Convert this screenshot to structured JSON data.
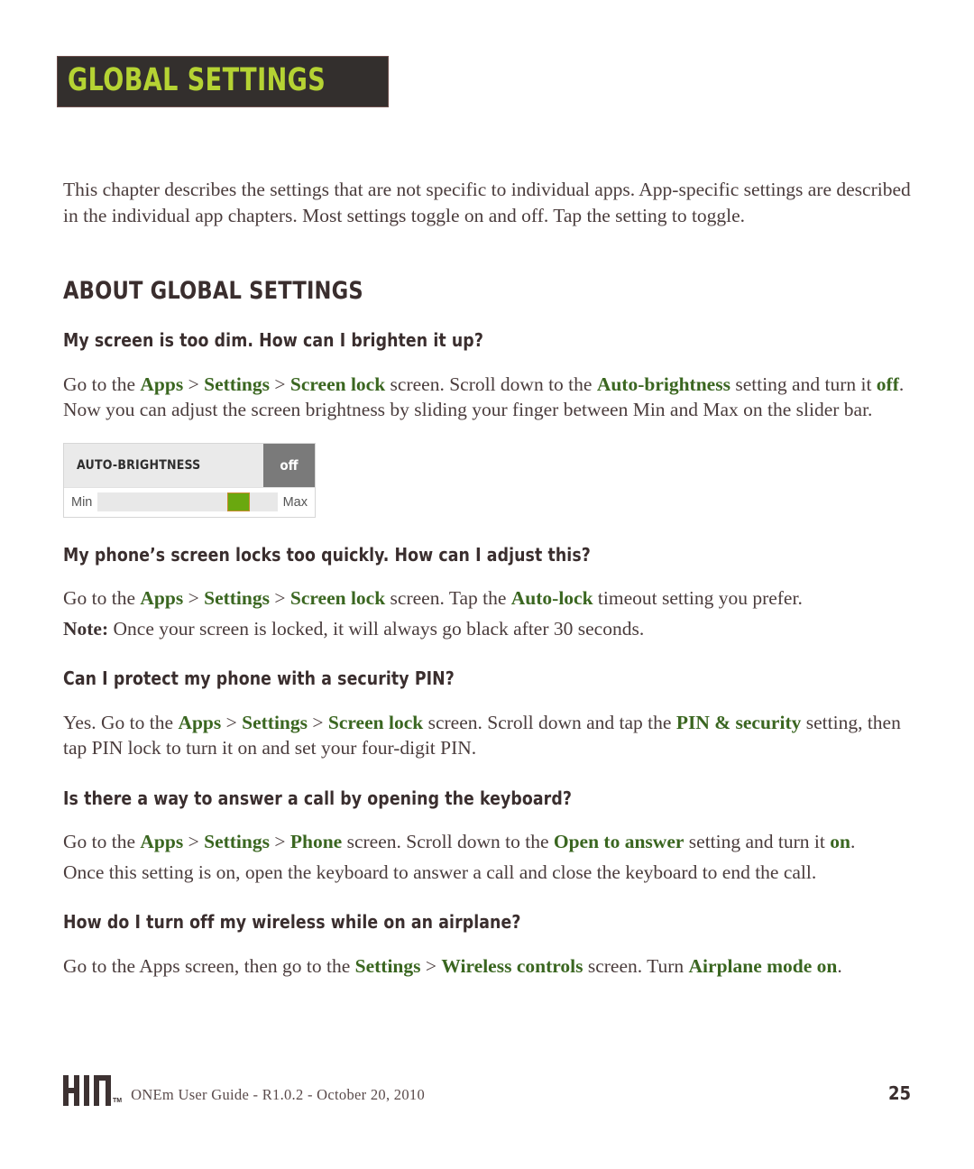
{
  "banner": {
    "title": "GLOBAL SETTINGS",
    "bg_color": "#332f2d",
    "text_color": "#b5d333"
  },
  "intro": {
    "paragraph": "This chapter describes the settings that are not specific to individual apps. App-specific settings are described in the individual app chapters. Most settings toggle on and off. Tap the setting to toggle."
  },
  "section": {
    "title": "ABOUT GLOBAL SETTINGS"
  },
  "accent_colors": {
    "green_term": "#3a6620",
    "heading": "#3a2e2e",
    "body": "#4a3c3c"
  },
  "faq": [
    {
      "question": "My screen is too dim. How can I brighten it up?",
      "answer_parts": [
        {
          "text": "Go to the ",
          "style": "plain"
        },
        {
          "text": "Apps",
          "style": "green"
        },
        {
          "text": " > ",
          "style": "plain"
        },
        {
          "text": "Settings",
          "style": "green"
        },
        {
          "text": " > ",
          "style": "plain"
        },
        {
          "text": "Screen lock",
          "style": "green"
        },
        {
          "text": " screen. Scroll down to the ",
          "style": "plain"
        },
        {
          "text": "Auto-brightness",
          "style": "green"
        },
        {
          "text": " setting and turn it ",
          "style": "plain"
        },
        {
          "text": "off",
          "style": "green"
        },
        {
          "text": ". Now you can adjust the screen brightness by sliding your finger between Min and Max on the slider bar.",
          "style": "plain"
        }
      ]
    },
    {
      "question": "My phone’s screen locks too quickly. How can I adjust this?",
      "answer_parts": [
        {
          "text": "Go to the ",
          "style": "plain"
        },
        {
          "text": "Apps",
          "style": "green"
        },
        {
          "text": " > ",
          "style": "plain"
        },
        {
          "text": "Settings",
          "style": "green"
        },
        {
          "text": " > ",
          "style": "plain"
        },
        {
          "text": "Screen lock",
          "style": "green"
        },
        {
          "text": " screen. Tap the ",
          "style": "plain"
        },
        {
          "text": "Auto-lock",
          "style": "green"
        },
        {
          "text": " timeout setting you prefer.",
          "style": "plain"
        }
      ],
      "answer2_parts": [
        {
          "text": "Note:",
          "style": "dark"
        },
        {
          "text": " Once your screen is locked, it will always go black after 30 seconds.",
          "style": "plain"
        }
      ]
    },
    {
      "question": "Can I protect my phone with a security PIN?",
      "answer_parts": [
        {
          "text": "Yes. Go to the ",
          "style": "plain"
        },
        {
          "text": "Apps",
          "style": "green"
        },
        {
          "text": " > ",
          "style": "plain"
        },
        {
          "text": "Settings",
          "style": "green"
        },
        {
          "text": " > ",
          "style": "plain"
        },
        {
          "text": "Screen lock",
          "style": "green"
        },
        {
          "text": " screen. Scroll down and tap the ",
          "style": "plain"
        },
        {
          "text": "PIN & security",
          "style": "green"
        },
        {
          "text": " setting, then tap PIN lock to turn it on and set your four-digit PIN.",
          "style": "plain"
        }
      ]
    },
    {
      "question": "Is there a way to answer a call by opening the keyboard?",
      "answer_parts": [
        {
          "text": "Go to the ",
          "style": "plain"
        },
        {
          "text": "Apps",
          "style": "green"
        },
        {
          "text": " > ",
          "style": "plain"
        },
        {
          "text": "Settings",
          "style": "green"
        },
        {
          "text": " > ",
          "style": "plain"
        },
        {
          "text": "Phone",
          "style": "green"
        },
        {
          "text": " screen. Scroll down to the ",
          "style": "plain"
        },
        {
          "text": "Open to answer",
          "style": "green"
        },
        {
          "text": " setting and turn it ",
          "style": "plain"
        },
        {
          "text": "on",
          "style": "green"
        },
        {
          "text": ".",
          "style": "plain"
        }
      ],
      "answer2_parts": [
        {
          "text": "Once this setting is on, open the keyboard to answer a call and close the keyboard to end the call.",
          "style": "plain"
        }
      ]
    },
    {
      "question": "How do I turn off my wireless while on an airplane?",
      "answer_parts": [
        {
          "text": "Go to the Apps screen, then go to the ",
          "style": "plain"
        },
        {
          "text": "Settings",
          "style": "green"
        },
        {
          "text": " > ",
          "style": "plain"
        },
        {
          "text": "Wireless controls",
          "style": "green"
        },
        {
          "text": " screen. Turn ",
          "style": "plain"
        },
        {
          "text": "Airplane mode on",
          "style": "green"
        },
        {
          "text": ".",
          "style": "plain"
        }
      ]
    }
  ],
  "brightness_widget": {
    "label": "AUTO-BRIGHTNESS",
    "state": "off",
    "min_label": "Min",
    "max_label": "Max",
    "handle_position_percent": 72,
    "handle_color": "#6aa80f",
    "state_bg_color": "#7a7a7a"
  },
  "footer": {
    "logo_name": "KIN",
    "trademark": "TM",
    "text": "ONEm User Guide - R1.0.2 - October 20, 2010",
    "page_number": "25"
  }
}
